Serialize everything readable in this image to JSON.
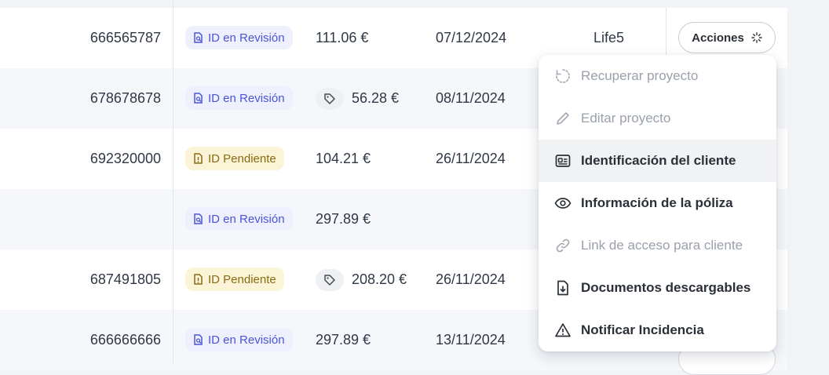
{
  "rows": [
    {
      "id": "666565787",
      "status": "ID en Revisión",
      "status_kind": "review",
      "price": "111.06 €",
      "has_tag": false,
      "date": "07/12/2024",
      "plan": "Life5"
    },
    {
      "id": "678678678",
      "status": "ID en Revisión",
      "status_kind": "review",
      "price": "56.28 €",
      "has_tag": true,
      "date": "08/11/2024",
      "plan": ""
    },
    {
      "id": "692320000",
      "status": "ID Pendiente",
      "status_kind": "pending",
      "price": "104.21 €",
      "has_tag": false,
      "date": "26/11/2024",
      "plan": ""
    },
    {
      "id": "",
      "status": "ID en Revisión",
      "status_kind": "review",
      "price": "297.89 €",
      "has_tag": false,
      "date": "",
      "plan": ""
    },
    {
      "id": "687491805",
      "status": "ID Pendiente",
      "status_kind": "pending",
      "price": "208.20 €",
      "has_tag": true,
      "date": "26/11/2024",
      "plan": ""
    },
    {
      "id": "666666666",
      "status": "ID en Revisión",
      "status_kind": "review",
      "price": "297.89 €",
      "has_tag": false,
      "date": "13/11/2024",
      "plan": ""
    }
  ],
  "actions_button": {
    "label": "Acciones",
    "icon": "loader-icon"
  },
  "menu": {
    "items": [
      {
        "label": "Recuperar proyecto",
        "icon": "refresh-icon",
        "enabled": false
      },
      {
        "label": "Editar proyecto",
        "icon": "pencil-icon",
        "enabled": false
      },
      {
        "label": "Identificación del cliente",
        "icon": "id-card-icon",
        "enabled": true,
        "hover": true
      },
      {
        "label": "Información de la póliza",
        "icon": "eye-icon",
        "enabled": true
      },
      {
        "label": "Link de acceso para cliente",
        "icon": "link-icon",
        "enabled": false
      },
      {
        "label": "Documentos descargables",
        "icon": "download-file-icon",
        "enabled": true
      },
      {
        "label": "Notificar Incidencia",
        "icon": "warning-icon",
        "enabled": true
      }
    ]
  },
  "colors": {
    "review_bg": "#eef0fd",
    "review_fg": "#4b54d8",
    "pending_bg": "#fcf4d6",
    "pending_fg": "#8a6b12",
    "row_alt": "#f5f7fa",
    "menu_hover": "#f1f2f4"
  }
}
